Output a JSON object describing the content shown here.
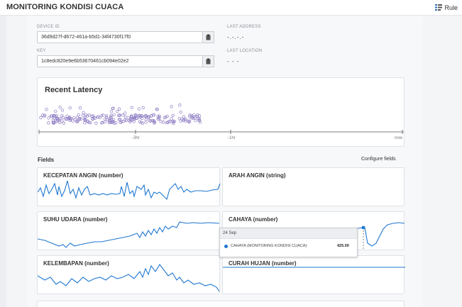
{
  "header": {
    "title": "MONITORING KONDISI CUACA",
    "rule_label": "Rule",
    "rule_icon": "rule-icon"
  },
  "device": {
    "device_id_label": "DEVICE ID",
    "device_id_value": "36d9d27f-d672-461a-b5d1-34f4730f17f0",
    "key_label": "KEY",
    "key_value": "1c8edc820e9e6b53670461cb094e02e2",
    "last_address_label": "LAST ADDRESS",
    "last_address_value": "-.-.-.-",
    "last_location_label": "LAST LOCATION",
    "last_location_value": "- - -",
    "copy_icon": "clipboard-icon"
  },
  "latency": {
    "title": "Recent Latency",
    "ticks": [
      "-3hr",
      "-1hr",
      "now"
    ]
  },
  "fields": {
    "title": "Fields",
    "configure_label": "Configure fields",
    "cards": [
      {
        "title": "KECEPATAN ANGIN (number)"
      },
      {
        "title": "ARAH ANGIN (string)"
      },
      {
        "title": "SUHU UDARA (number)"
      },
      {
        "title": "CAHAYA (number)"
      },
      {
        "title": "KELEMBAPAN (number)"
      },
      {
        "title": "CURAH HUJAN (number)"
      }
    ]
  },
  "tooltip": {
    "date": "24 Sep",
    "series": "CAHAYA (MONITORING KONDISI CUACA):",
    "value": "425.00"
  },
  "colors": {
    "line": "#1f77d0",
    "latency_points": "#8e7cc3"
  }
}
